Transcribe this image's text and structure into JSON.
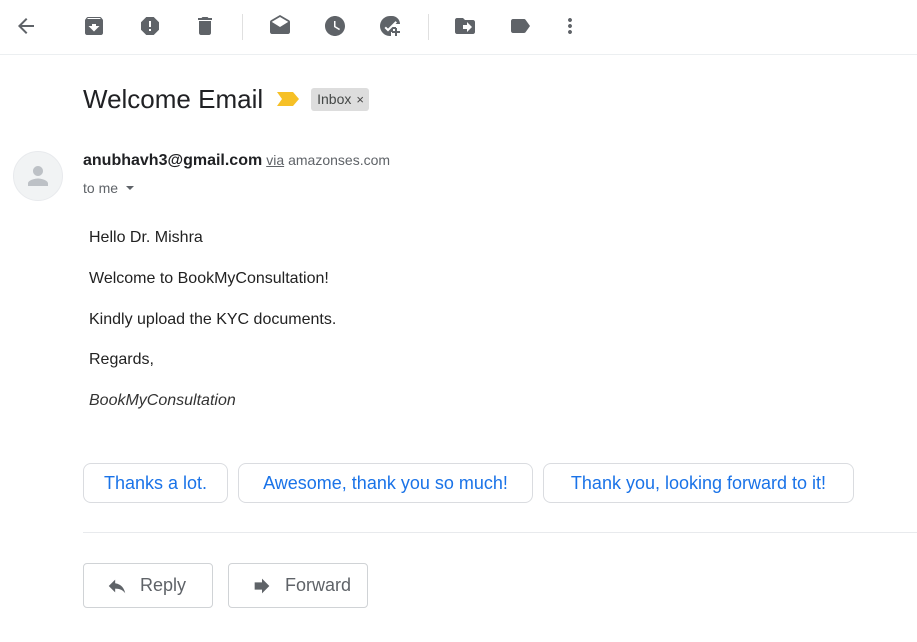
{
  "toolbar": {
    "icons": [
      "back-arrow-icon",
      "archive-icon",
      "report-spam-icon",
      "delete-icon",
      "mark-unread-icon",
      "snooze-icon",
      "add-to-tasks-icon",
      "move-to-icon",
      "labels-icon",
      "more-vert-icon"
    ]
  },
  "email": {
    "subject": "Welcome Email",
    "label": "Inbox",
    "label_remove": "×",
    "importance_color": "#f6c026",
    "sender_email": "anubhavh3@gmail.com",
    "via": "via",
    "via_domain": "amazonses.com",
    "to": "to me",
    "body": [
      "Hello Dr. Mishra",
      "Welcome to BookMyConsultation!",
      "Kindly upload the KYC documents.",
      "Regards,",
      "BookMyConsultation"
    ]
  },
  "smart_replies": [
    "Thanks a lot.",
    "Awesome, thank you so much!",
    "Thank you, looking forward to it!"
  ],
  "actions": {
    "reply": "Reply",
    "forward": "Forward"
  },
  "colors": {
    "accent": "#1a73e8",
    "icon": "#5f6368"
  }
}
